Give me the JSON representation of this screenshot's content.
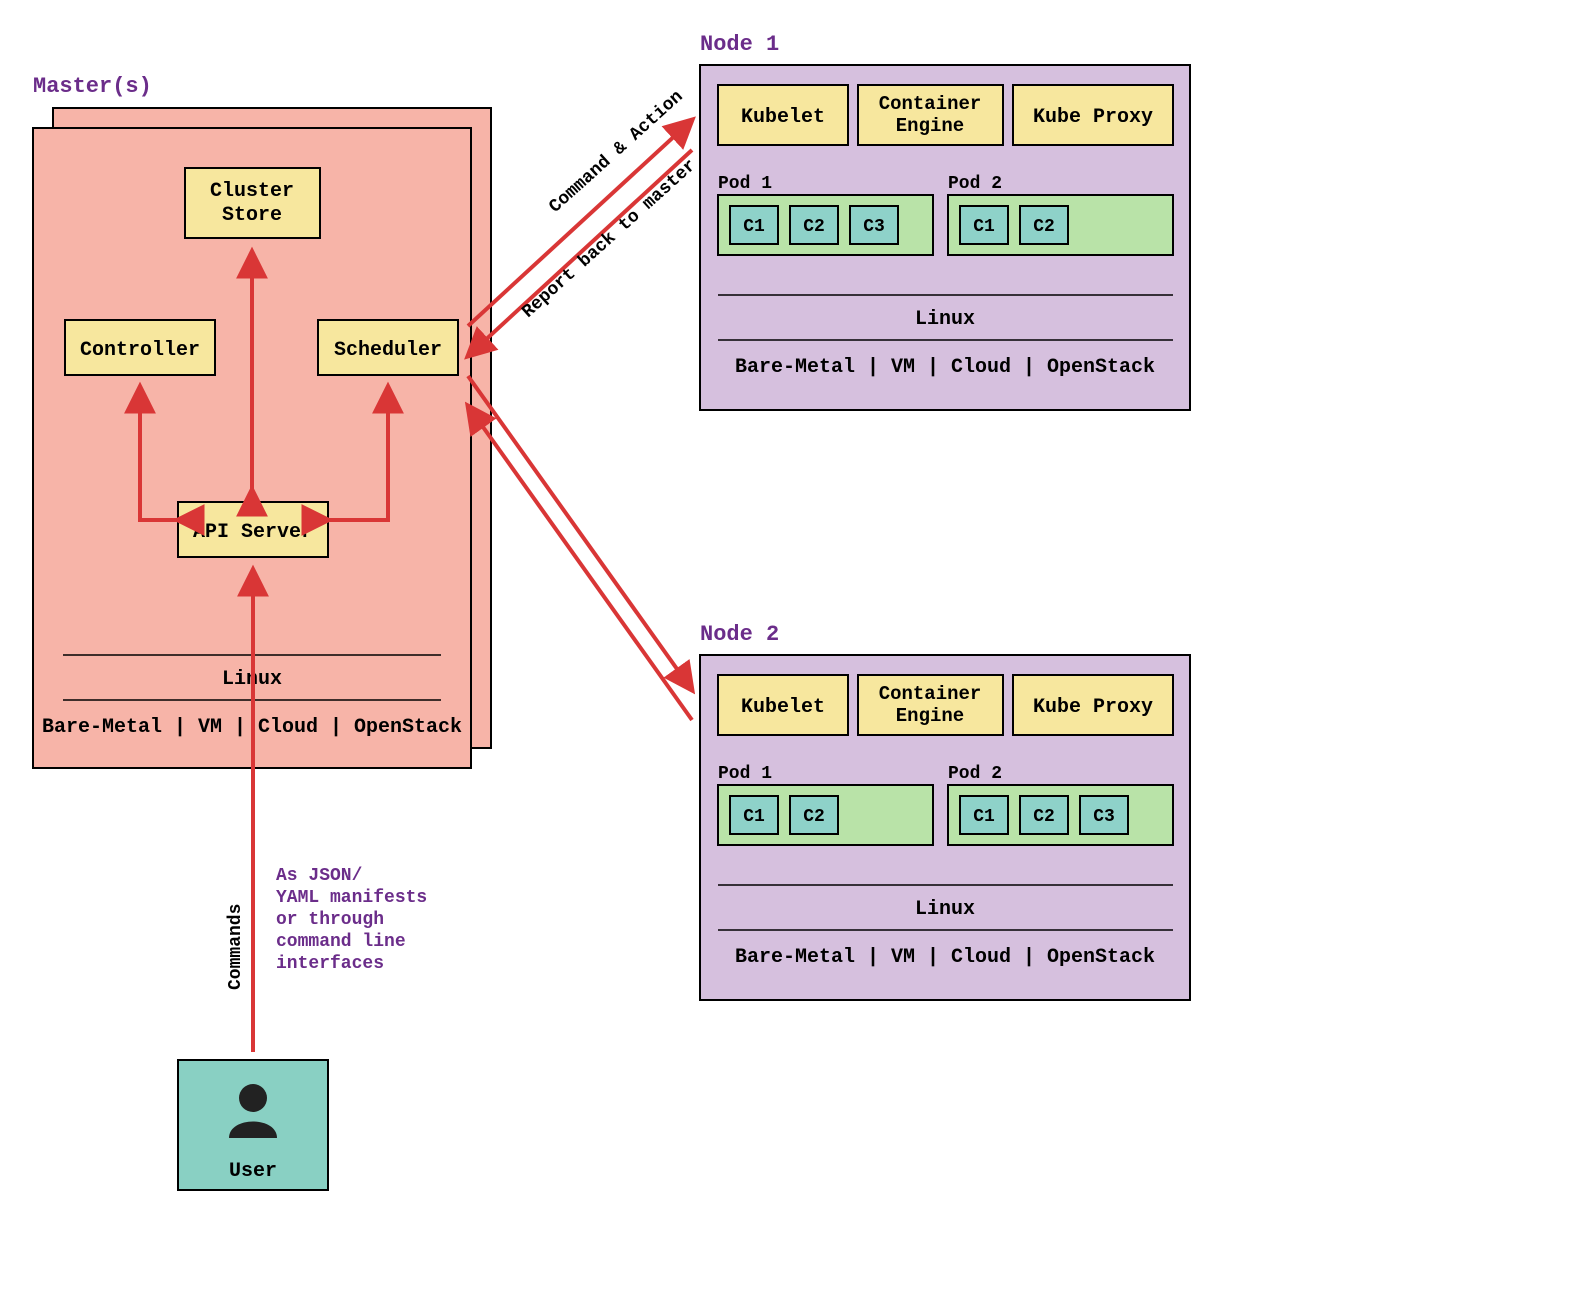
{
  "master": {
    "title": "Master(s)",
    "boxes": {
      "cluster_store_l1": "Cluster",
      "cluster_store_l2": "Store",
      "controller": "Controller",
      "scheduler": "Scheduler",
      "api_server": "API Server"
    },
    "os": "Linux",
    "infra": "Bare-Metal | VM | Cloud | OpenStack"
  },
  "node1": {
    "title": "Node 1",
    "kubelet": "Kubelet",
    "container_engine_l1": "Container",
    "container_engine_l2": "Engine",
    "kube_proxy": "Kube Proxy",
    "pod1": {
      "title": "Pod 1",
      "containers": [
        "C1",
        "C2",
        "C3"
      ]
    },
    "pod2": {
      "title": "Pod 2",
      "containers": [
        "C1",
        "C2"
      ]
    },
    "os": "Linux",
    "infra": "Bare-Metal | VM | Cloud | OpenStack"
  },
  "node2": {
    "title": "Node 2",
    "kubelet": "Kubelet",
    "container_engine_l1": "Container",
    "container_engine_l2": "Engine",
    "kube_proxy": "Kube Proxy",
    "pod1": {
      "title": "Pod 1",
      "containers": [
        "C1",
        "C2"
      ]
    },
    "pod2": {
      "title": "Pod 2",
      "containers": [
        "C1",
        "C2",
        "C3"
      ]
    },
    "os": "Linux",
    "infra": "Bare-Metal | VM | Cloud | OpenStack"
  },
  "user": {
    "label": "User"
  },
  "arrows": {
    "commands": "Commands",
    "command_action": "Command & Action",
    "report_back": "Report back to master"
  },
  "user_note": {
    "l1": "As JSON/",
    "l2": "YAML manifests",
    "l3": "or through",
    "l4": "command line",
    "l5": "interfaces"
  }
}
